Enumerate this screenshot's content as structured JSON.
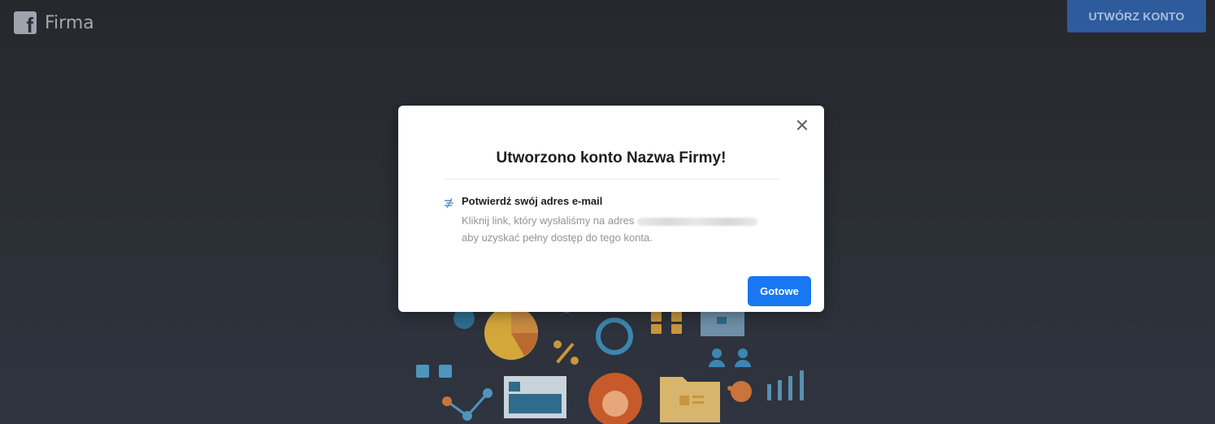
{
  "header": {
    "brand_name": "Firma",
    "create_account_label": "UTWÓRZ KONTO"
  },
  "modal": {
    "title": "Utworzono konto Nazwa Firmy!",
    "close_icon": "close-icon",
    "notice": {
      "icon": "email-confirm-icon",
      "heading": "Potwierdź swój adres e-mail",
      "body_line1": "Kliknij link, który wysłaliśmy na adres",
      "body_line2": "aby uzyskać pełny dostęp do tego konta."
    },
    "done_label": "Gotowe"
  },
  "colors": {
    "primary": "#1877f2",
    "header_button": "#2e5b9c",
    "overlay_bg": "#2b2f36"
  }
}
